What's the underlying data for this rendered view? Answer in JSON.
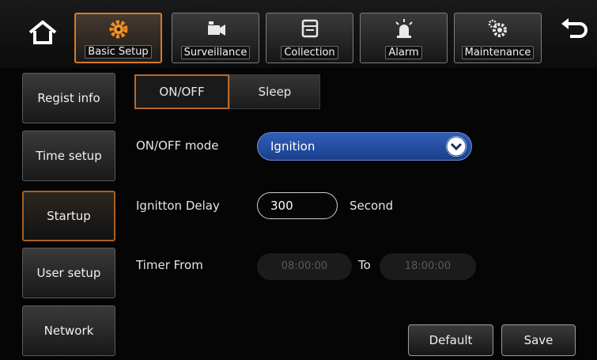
{
  "nav": {
    "tabs": [
      {
        "label": "Basic Setup",
        "icon": "gear-icon",
        "active": true
      },
      {
        "label": "Surveillance",
        "icon": "camera-icon",
        "active": false
      },
      {
        "label": "Collection",
        "icon": "storage-icon",
        "active": false
      },
      {
        "label": "Alarm",
        "icon": "alarm-light-icon",
        "active": false
      },
      {
        "label": "Maintenance",
        "icon": "gears-icon",
        "active": false
      }
    ],
    "home_icon": "home-icon",
    "back_icon": "back-arrow-icon"
  },
  "sidebar": {
    "items": [
      {
        "label": "Regist info"
      },
      {
        "label": "Time setup"
      },
      {
        "label": "Startup",
        "active": true
      },
      {
        "label": "User setup"
      },
      {
        "label": "Network"
      }
    ]
  },
  "subtabs": [
    {
      "label": "ON/OFF",
      "active": true
    },
    {
      "label": "Sleep",
      "active": false
    }
  ],
  "form": {
    "onoff_mode_label": "ON/OFF mode",
    "onoff_mode_value": "Ignition",
    "delay_label": "Ignitton Delay",
    "delay_value": "300",
    "delay_unit": "Second",
    "timer_label": "Timer From",
    "timer_from": "08:00:00",
    "timer_to_label": "To",
    "timer_to": "18:00:00"
  },
  "buttons": {
    "default_label": "Default",
    "save_label": "Save"
  },
  "colors": {
    "accent": "#d57a2a",
    "select_blue": "#2f5fb8"
  }
}
